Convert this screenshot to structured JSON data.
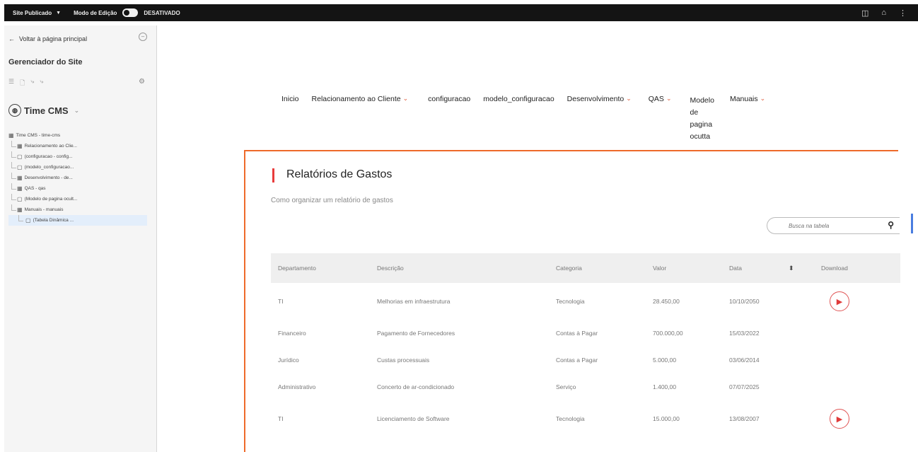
{
  "topbar": {
    "site_status": "Site Publicado",
    "edit_mode": "Modo de Edição",
    "edit_state": "DESATIVADO"
  },
  "sidebar": {
    "back_label": "Voltar à página principal",
    "title": "Gerenciador do Site",
    "site_name": "Time CMS",
    "tree": [
      {
        "label": "Time CMS - time-cms",
        "level": 0
      },
      {
        "label": "Relacionamento ao Clie...",
        "level": 1
      },
      {
        "label": "(configuracao - config...",
        "level": 1
      },
      {
        "label": "(modelo_configuracao...",
        "level": 1
      },
      {
        "label": "Desenvolvimento - de...",
        "level": 1
      },
      {
        "label": "QAS - qas",
        "level": 1
      },
      {
        "label": "(Modelo de pagina ocult...",
        "level": 1
      },
      {
        "label": "Manuais - manuais",
        "level": 1
      },
      {
        "label": "(Tabela Dinâmica ...",
        "level": 2,
        "selected": true
      }
    ]
  },
  "nav": {
    "inicio": "Inicio",
    "relacionamento": "Relacionamento ao Cliente",
    "configuracao": "configuracao",
    "modelo_configuracao": "modelo_configuracao",
    "desenvolvimento": "Desenvolvimento",
    "qas": "QAS",
    "modelo_line1": "Modelo",
    "modelo_line2": "de",
    "modelo_line3": "pagina",
    "modelo_line4": "ocutta",
    "manuais": "Manuais"
  },
  "panel": {
    "title": "Relatórios de Gastos",
    "subtitle": "Como organizar um relatório de gastos",
    "search_placeholder": "Busca na tabela"
  },
  "table": {
    "headers": [
      "Departamento",
      "Descrição",
      "Categoria",
      "Valor",
      "Data",
      "Download"
    ],
    "rows": [
      {
        "dept": "TI",
        "desc": "Melhorias em infraestrutura",
        "cat": "Tecnologia",
        "valor": "28.450,00",
        "data": "10/10/2050",
        "download": true
      },
      {
        "dept": "Financeiro",
        "desc": "Pagamento de Fornecedores",
        "cat": "Contas à Pagar",
        "valor": "700.000,00",
        "data": "15/03/2022",
        "download": false
      },
      {
        "dept": "Jurídico",
        "desc": "Custas processuais",
        "cat": "Contas a Pagar",
        "valor": "5.000,00",
        "data": "03/06/2014",
        "download": false
      },
      {
        "dept": "Administrativo",
        "desc": "Concerto de ar-condicionado",
        "cat": "Serviço",
        "valor": "1.400,00",
        "data": "07/07/2025",
        "download": false
      },
      {
        "dept": "TI",
        "desc": "Licenciamento de Software",
        "cat": "Tecnologia",
        "valor": "15.000,00",
        "data": "13/08/2007",
        "download": true
      }
    ]
  },
  "colors": {
    "accent": "#ee6a2a",
    "title_bar": "#e83b3b",
    "topbar_bg": "#141414"
  }
}
